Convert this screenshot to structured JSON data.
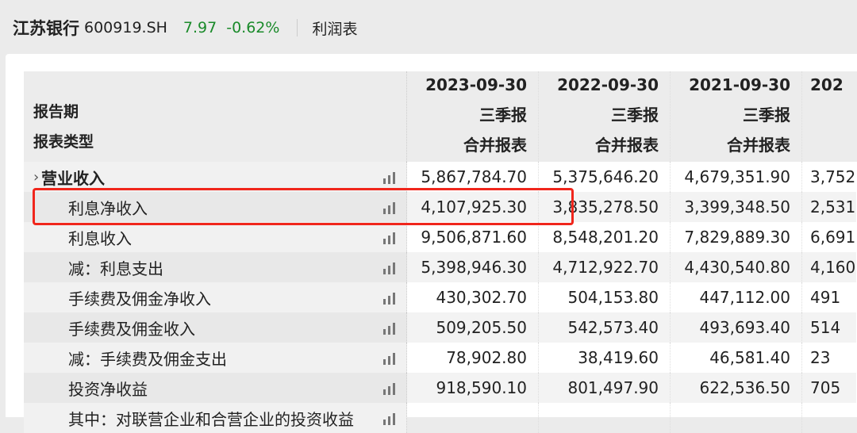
{
  "header": {
    "company": "江苏银行",
    "code": "600919.SH",
    "price": "7.97",
    "change": "-0.62%",
    "section": "利润表"
  },
  "table": {
    "label_headers": [
      "报告期",
      "报表类型"
    ],
    "columns": [
      {
        "date": "2023-09-30",
        "period": "三季报",
        "type": "合并报表"
      },
      {
        "date": "2022-09-30",
        "period": "三季报",
        "type": "合并报表"
      },
      {
        "date": "2021-09-30",
        "period": "三季报",
        "type": "合并报表"
      },
      {
        "date": "202",
        "period": "",
        "type": ""
      }
    ],
    "rows": [
      {
        "label": "营业收入",
        "top": true,
        "values": [
          "5,867,784.70",
          "5,375,646.20",
          "4,679,351.90",
          "3,752"
        ]
      },
      {
        "label": "利息净收入",
        "values": [
          "4,107,925.30",
          "3,835,278.50",
          "3,399,348.50",
          "2,531"
        ]
      },
      {
        "label": "利息收入",
        "values": [
          "9,506,871.60",
          "8,548,201.20",
          "7,829,889.30",
          "6,691"
        ]
      },
      {
        "label": "减：利息支出",
        "values": [
          "5,398,946.30",
          "4,712,922.70",
          "4,430,540.80",
          "4,160"
        ]
      },
      {
        "label": "手续费及佣金净收入",
        "values": [
          "430,302.70",
          "504,153.80",
          "447,112.00",
          "491"
        ]
      },
      {
        "label": "手续费及佣金收入",
        "values": [
          "509,205.50",
          "542,573.40",
          "493,693.40",
          "514"
        ]
      },
      {
        "label": "减：手续费及佣金支出",
        "values": [
          "78,902.80",
          "38,419.60",
          "46,581.40",
          "23"
        ]
      },
      {
        "label": "投资净收益",
        "values": [
          "918,590.10",
          "801,497.90",
          "622,536.50",
          "705"
        ]
      },
      {
        "label": "其中：对联营企业和合营企业的投资收益",
        "values": [
          "",
          "",
          "",
          ""
        ]
      }
    ]
  },
  "colors": {
    "up_down": "#1a8a2a",
    "highlight": "#f0261c"
  }
}
